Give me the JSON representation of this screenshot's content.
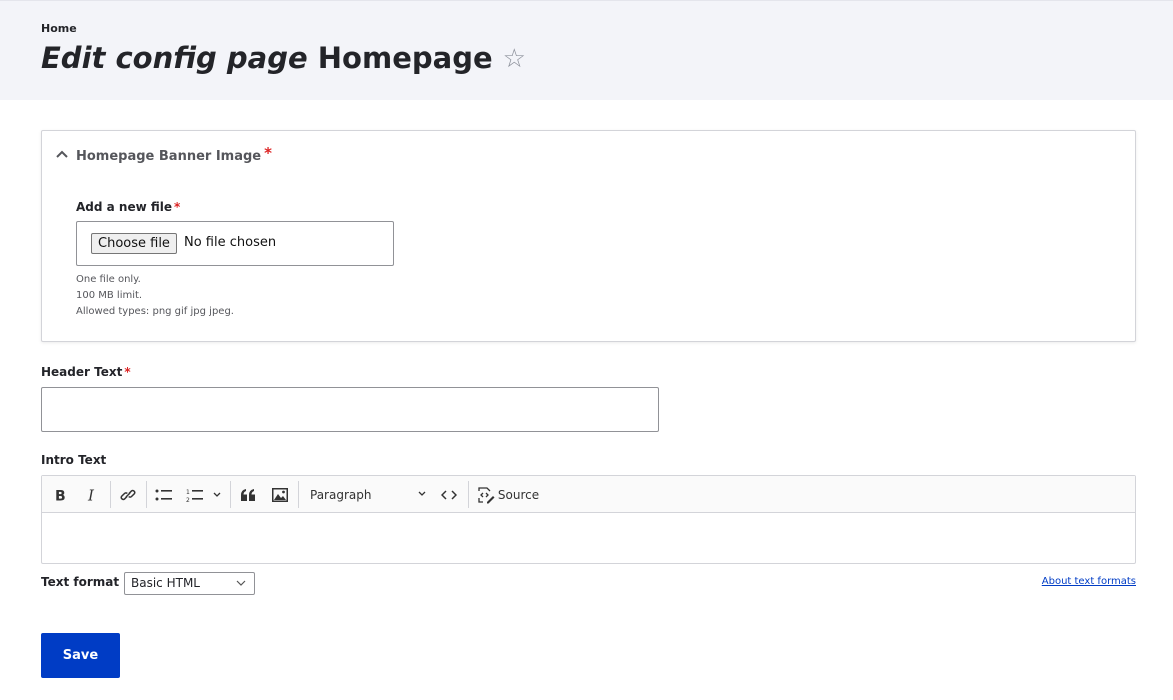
{
  "header": {
    "breadcrumb": "Home",
    "title_prefix": "Edit config page",
    "title_entity": "Homepage",
    "star_icon": "☆"
  },
  "banner_section": {
    "summary_label": "Homepage Banner Image",
    "required_mark": "*",
    "file_field": {
      "label": "Add a new file",
      "required_mark": "*",
      "button_label": "Choose file",
      "status_text": "No file chosen",
      "description": [
        "One file only.",
        "100 MB limit.",
        "Allowed types: png gif jpg jpeg."
      ]
    }
  },
  "header_text": {
    "label": "Header Text",
    "required_mark": "*",
    "value": ""
  },
  "intro_text": {
    "label": "Intro Text",
    "toolbar": {
      "bold": "bold-icon",
      "italic": "italic-icon",
      "link": "link-icon",
      "bulleted_list": "bulleted-list-icon",
      "numbered_list": "numbered-list-icon",
      "block_quote": "block-quote-icon",
      "image": "image-icon",
      "heading_select": "Paragraph",
      "code": "code-icon",
      "source_label": "Source"
    },
    "value": ""
  },
  "text_format": {
    "label": "Text format",
    "selected": "Basic HTML",
    "about_link": "About text formats"
  },
  "actions": {
    "save_label": "Save"
  },
  "colors": {
    "primary": "#003cc5",
    "required": "#dc2323",
    "header_bg": "#f3f4f9"
  }
}
